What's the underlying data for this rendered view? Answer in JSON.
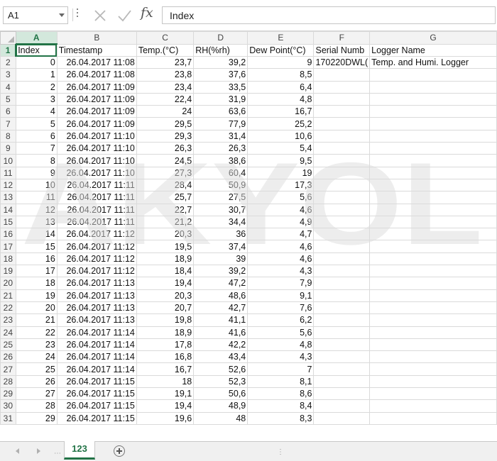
{
  "formula_bar": {
    "name_box": "A1",
    "formula_value": "Index",
    "fx_label": "fx",
    "cancel_icon": "x-icon",
    "enter_icon": "check-icon"
  },
  "columns": [
    "A",
    "B",
    "C",
    "D",
    "E",
    "F",
    "G"
  ],
  "active_column": "A",
  "active_row": 1,
  "header_row": [
    "Index",
    "Timestamp",
    "Temp.(°C)",
    "RH(%rh)",
    "Dew Point(°C)",
    "Serial Numb",
    "Logger Name"
  ],
  "row2_extra": {
    "serial": "170220DWL(",
    "logger": "Temp. and Humi. Logger"
  },
  "rows": [
    {
      "row": "2",
      "index": "0",
      "ts": "26.04.2017 11:08",
      "temp": "23,7",
      "rh": "39,2",
      "dew": "9"
    },
    {
      "row": "3",
      "index": "1",
      "ts": "26.04.2017 11:08",
      "temp": "23,8",
      "rh": "37,6",
      "dew": "8,5"
    },
    {
      "row": "4",
      "index": "2",
      "ts": "26.04.2017 11:09",
      "temp": "23,4",
      "rh": "33,5",
      "dew": "6,4"
    },
    {
      "row": "5",
      "index": "3",
      "ts": "26.04.2017 11:09",
      "temp": "22,4",
      "rh": "31,9",
      "dew": "4,8"
    },
    {
      "row": "6",
      "index": "4",
      "ts": "26.04.2017 11:09",
      "temp": "24",
      "rh": "63,6",
      "dew": "16,7"
    },
    {
      "row": "7",
      "index": "5",
      "ts": "26.04.2017 11:09",
      "temp": "29,5",
      "rh": "77,9",
      "dew": "25,2"
    },
    {
      "row": "8",
      "index": "6",
      "ts": "26.04.2017 11:10",
      "temp": "29,3",
      "rh": "31,4",
      "dew": "10,6"
    },
    {
      "row": "9",
      "index": "7",
      "ts": "26.04.2017 11:10",
      "temp": "26,3",
      "rh": "26,3",
      "dew": "5,4"
    },
    {
      "row": "10",
      "index": "8",
      "ts": "26.04.2017 11:10",
      "temp": "24,5",
      "rh": "38,6",
      "dew": "9,5"
    },
    {
      "row": "11",
      "index": "9",
      "ts": "26.04.2017 11:10",
      "temp": "27,3",
      "rh": "60,4",
      "dew": "19"
    },
    {
      "row": "12",
      "index": "10",
      "ts": "26.04.2017 11:11",
      "temp": "28,4",
      "rh": "50,9",
      "dew": "17,3"
    },
    {
      "row": "13",
      "index": "11",
      "ts": "26.04.2017 11:11",
      "temp": "25,7",
      "rh": "27,5",
      "dew": "5,6"
    },
    {
      "row": "14",
      "index": "12",
      "ts": "26.04.2017 11:11",
      "temp": "22,7",
      "rh": "30,7",
      "dew": "4,6"
    },
    {
      "row": "15",
      "index": "13",
      "ts": "26.04.2017 11:11",
      "temp": "21,2",
      "rh": "34,4",
      "dew": "4,9"
    },
    {
      "row": "16",
      "index": "14",
      "ts": "26.04.2017 11:12",
      "temp": "20,3",
      "rh": "36",
      "dew": "4,7"
    },
    {
      "row": "17",
      "index": "15",
      "ts": "26.04.2017 11:12",
      "temp": "19,5",
      "rh": "37,4",
      "dew": "4,6"
    },
    {
      "row": "18",
      "index": "16",
      "ts": "26.04.2017 11:12",
      "temp": "18,9",
      "rh": "39",
      "dew": "4,6"
    },
    {
      "row": "19",
      "index": "17",
      "ts": "26.04.2017 11:12",
      "temp": "18,4",
      "rh": "39,2",
      "dew": "4,3"
    },
    {
      "row": "20",
      "index": "18",
      "ts": "26.04.2017 11:13",
      "temp": "19,4",
      "rh": "47,2",
      "dew": "7,9"
    },
    {
      "row": "21",
      "index": "19",
      "ts": "26.04.2017 11:13",
      "temp": "20,3",
      "rh": "48,6",
      "dew": "9,1"
    },
    {
      "row": "22",
      "index": "20",
      "ts": "26.04.2017 11:13",
      "temp": "20,7",
      "rh": "42,7",
      "dew": "7,6"
    },
    {
      "row": "23",
      "index": "21",
      "ts": "26.04.2017 11:13",
      "temp": "19,8",
      "rh": "41,1",
      "dew": "6,2"
    },
    {
      "row": "24",
      "index": "22",
      "ts": "26.04.2017 11:14",
      "temp": "18,9",
      "rh": "41,6",
      "dew": "5,6"
    },
    {
      "row": "25",
      "index": "23",
      "ts": "26.04.2017 11:14",
      "temp": "17,8",
      "rh": "42,2",
      "dew": "4,8"
    },
    {
      "row": "26",
      "index": "24",
      "ts": "26.04.2017 11:14",
      "temp": "16,8",
      "rh": "43,4",
      "dew": "4,3"
    },
    {
      "row": "27",
      "index": "25",
      "ts": "26.04.2017 11:14",
      "temp": "16,7",
      "rh": "52,6",
      "dew": "7"
    },
    {
      "row": "28",
      "index": "26",
      "ts": "26.04.2017 11:15",
      "temp": "18",
      "rh": "52,3",
      "dew": "8,1"
    },
    {
      "row": "29",
      "index": "27",
      "ts": "26.04.2017 11:15",
      "temp": "19,1",
      "rh": "50,6",
      "dew": "8,6"
    },
    {
      "row": "30",
      "index": "28",
      "ts": "26.04.2017 11:15",
      "temp": "19,4",
      "rh": "48,9",
      "dew": "8,4"
    },
    {
      "row": "31",
      "index": "29",
      "ts": "26.04.2017 11:15",
      "temp": "19,6",
      "rh": "48",
      "dew": "8,3"
    }
  ],
  "watermark": "AKYOL",
  "sheet_tab": {
    "name": "123"
  },
  "colors": {
    "accent": "#217346",
    "header_bg": "#f3f3f3",
    "active_header_bg": "#d3e8dc",
    "gridline": "#dadada"
  }
}
